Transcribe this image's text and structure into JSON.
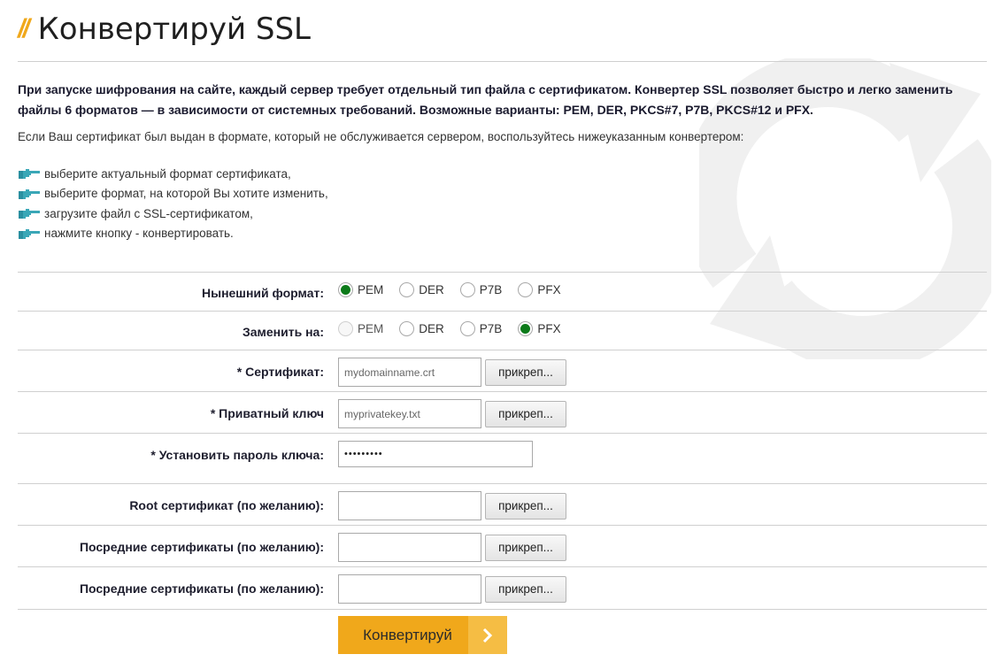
{
  "header": {
    "slashes": "//",
    "title": "Конвертируй SSL"
  },
  "intro_text": "При запуске шифрования на сайте, каждый сервер требует отдельный тип файла с сертификатом. Конвертер SSL позволяет быстро и легко заменить файлы 6 форматов — в зависимости от системных требований. Возможные варианты: PEM, DER, PKCS#7, P7B, PKCS#12 и PFX.",
  "note_text": "Если Ваш сертификат был выдан в формате, который не обслуживается сервером, воспользуйтесь нижеуказанным конвертером:",
  "steps": [
    "выберите актуальный формат сертификата,",
    "выберите формат, на которой Вы хотите изменить,",
    "загрузите файл с SSL-сертификатом,",
    "нажмите кнопку - конвертировать."
  ],
  "form": {
    "current_format": {
      "label": "Нынешний формат:",
      "options": [
        "PEM",
        "DER",
        "P7B",
        "PFX"
      ],
      "selected": "PEM"
    },
    "convert_to": {
      "label": "Заменить на:",
      "options": [
        "PEM",
        "DER",
        "P7B",
        "PFX"
      ],
      "selected": "PFX",
      "disabled": "PEM"
    },
    "certificate": {
      "label": "* Сертификат:",
      "placeholder": "mydomainname.crt",
      "button": "прикреп..."
    },
    "private_key": {
      "label": "* Приватный ключ",
      "placeholder": "myprivatekey.txt",
      "button": "прикреп..."
    },
    "key_password": {
      "label": "* Установить пароль ключа:",
      "value": "•••••••••"
    },
    "root_cert": {
      "label": "Root сертификат (по желанию):",
      "value": "",
      "button": "прикреп..."
    },
    "intermediate_1": {
      "label": "Посредние сертификаты (по желанию):",
      "value": "",
      "button": "прикреп..."
    },
    "intermediate_2": {
      "label": "Посредние сертификаты (по желанию):",
      "value": "",
      "button": "прикреп..."
    },
    "submit_label": "Конвертируй"
  },
  "colors": {
    "accent": "#f0a81b",
    "radio_checked": "#0c7a19",
    "step_icon": "#3aa7b7",
    "background_arrows": "#f0f0f0"
  },
  "icons": {
    "step": "pointing-hand-icon",
    "submit": "chevron-right-icon",
    "background": "refresh-arrows-icon"
  }
}
